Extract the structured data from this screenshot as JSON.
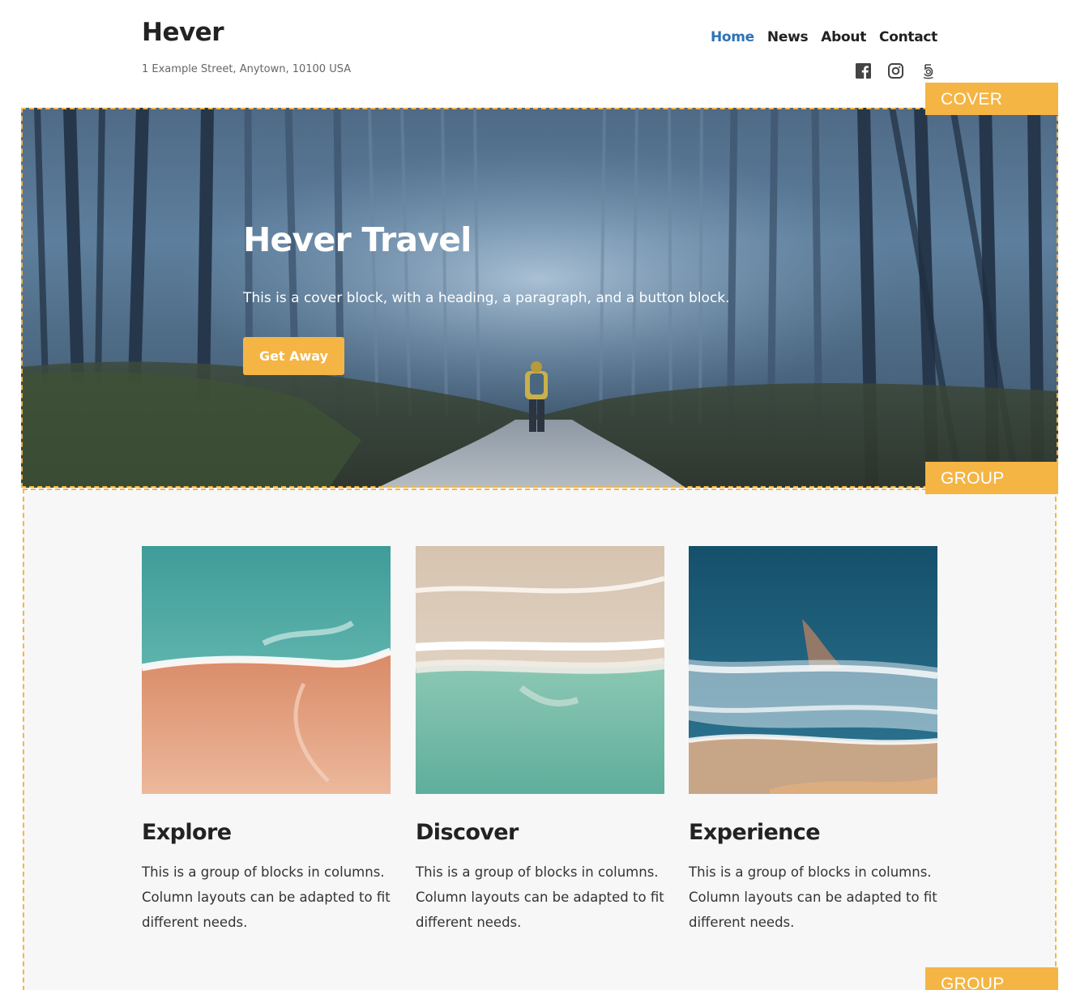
{
  "site": {
    "title": "Hever",
    "description": "1 Example Street, Anytown, 10100 USA"
  },
  "nav": {
    "items": [
      {
        "label": "Home",
        "active": true
      },
      {
        "label": "News",
        "active": false
      },
      {
        "label": "About",
        "active": false
      },
      {
        "label": "Contact",
        "active": false
      }
    ]
  },
  "social": {
    "icons": [
      "facebook-icon",
      "instagram-icon",
      "fivehundredpx-icon"
    ]
  },
  "labels": {
    "cover": "COVER",
    "group": "GROUP",
    "group_bottom": "GROUP"
  },
  "cover": {
    "title": "Hever Travel",
    "text": "This is a cover block, with a heading, a paragraph, and a button block.",
    "button": "Get Away"
  },
  "columns": [
    {
      "title": "Explore",
      "text": "This is a group of blocks in columns. Column layouts can be adapted to fit different needs."
    },
    {
      "title": "Discover",
      "text": "This is a group of blocks in columns. Column layouts can be adapted to fit different needs."
    },
    {
      "title": "Experience",
      "text": "This is a group of blocks in columns. Column layouts can be adapted to fit different needs."
    }
  ],
  "colors": {
    "accent": "#f4b544",
    "link_active": "#2f72b4",
    "text": "#222222"
  }
}
